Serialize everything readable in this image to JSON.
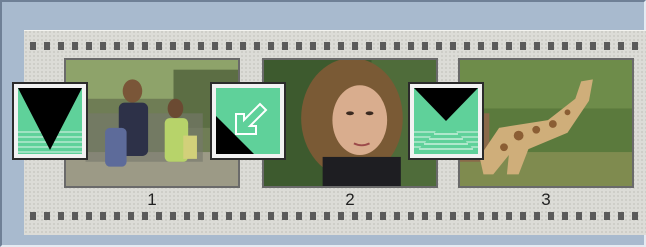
{
  "filmstrip": {
    "frames": [
      {
        "number": "1",
        "transition_icon": "wipe-down-triangle-icon"
      },
      {
        "number": "2",
        "transition_icon": "diagonal-arrow-wipe-icon"
      },
      {
        "number": "3",
        "transition_icon": "hourglass-wipe-icon"
      }
    ]
  },
  "colors": {
    "transition_green": "#5fd19a",
    "transition_dark": "#000000",
    "strip_background": "#dcdcd7",
    "panel_background": "#a8bace"
  }
}
